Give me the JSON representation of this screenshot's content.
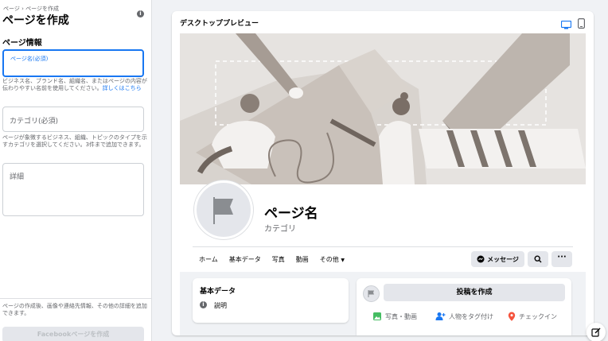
{
  "sidebar": {
    "breadcrumb": "ページ › ページを作成",
    "title": "ページを作成",
    "section_title": "ページ情報",
    "name_field": {
      "placeholder": "ページ名(必須)"
    },
    "name_help": "ビジネス名、ブランド名、組織名、またはページの内容が伝わりやすい名前を使用してください。",
    "name_help_link": "詳しくはこちら",
    "category_field": {
      "placeholder": "カテゴリ(必須)"
    },
    "category_help": "ページが象徴するビジネス、組織、トピックのタイプを示すカテゴリを選択してください。3件まで追加できます。",
    "details_field": {
      "placeholder": "詳細"
    },
    "bottom_note": "ページの作成後、画像や連絡先情報、その他の詳細を追加できます。",
    "create_button": "Facebookページを作成"
  },
  "preview": {
    "title": "デスクトッププレビュー",
    "page_name": "ページ名",
    "category": "カテゴリ",
    "tabs": [
      "ホーム",
      "基本データ",
      "写真",
      "動画",
      "その他"
    ],
    "message_button": "メッセージ",
    "about_title": "基本データ",
    "about_item": "説明",
    "create_post": "投稿を作成",
    "actions": [
      "写真・動画",
      "人物をタグ付け",
      "チェックイン"
    ],
    "colors": {
      "accent": "#1877f2",
      "photo": "#45bd62",
      "tag": "#1877f2",
      "checkin": "#f5533d"
    }
  }
}
